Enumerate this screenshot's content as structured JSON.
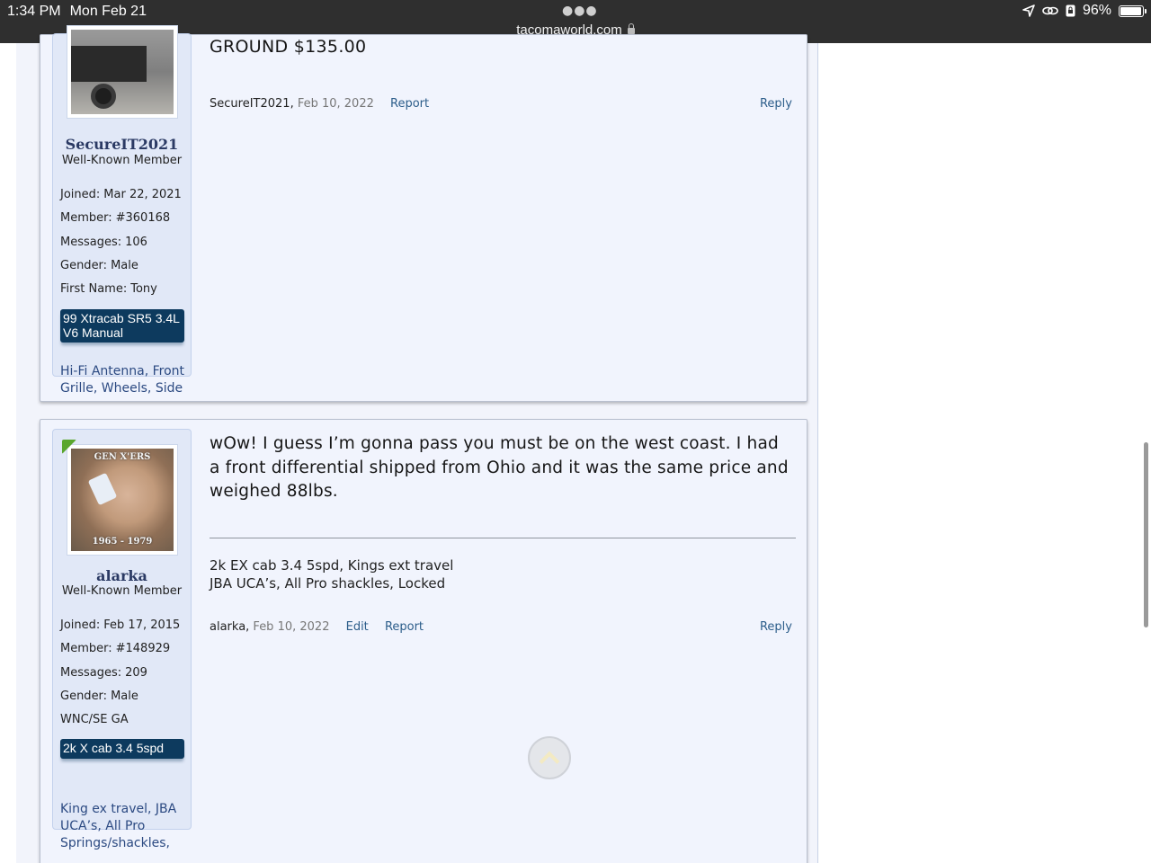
{
  "status_bar": {
    "time": "1:34 PM",
    "date": "Mon Feb 21",
    "url": "tacomaworld.com",
    "battery": "96%",
    "battery_level": 0.96
  },
  "posts": [
    {
      "message": "GROUND $135.00",
      "user": {
        "username": "SecureIT2021",
        "title": "Well-Known Member",
        "stats": [
          {
            "label": "Joined:",
            "value": "Mar 22, 2021"
          },
          {
            "label": "Member:",
            "value": "#360168"
          },
          {
            "label": "Messages:",
            "value": "106"
          },
          {
            "label": "Gender:",
            "value": "Male"
          },
          {
            "label": "First Name:",
            "value": "Tony"
          }
        ],
        "vehicle": "99 Xtracab SR5 3.4L V6 Manual",
        "mods": "Hi-Fi Antenna, Front Grille, Wheels, Side"
      },
      "meta": {
        "author": "SecureIT2021",
        "date": "Feb 10, 2022",
        "report": "Report",
        "reply": "Reply"
      }
    },
    {
      "message": "wOw! I guess I’m gonna pass you must be on the west coast. I had a front differential shipped from Ohio and it was the same price and weighed 88lbs.",
      "signature_line1": "2k EX cab 3.4 5spd, Kings ext travel",
      "signature_line2": "JBA UCA’s, All Pro shackles, Locked",
      "user": {
        "username": "alarka",
        "title": "Well-Known Member",
        "avatar_text_top": "GEN X'ERS",
        "avatar_text_bottom": "1965 - 1979",
        "stats": [
          {
            "label": "Joined:",
            "value": "Feb 17, 2015"
          },
          {
            "label": "Member:",
            "value": "#148929"
          },
          {
            "label": "Messages:",
            "value": "209"
          },
          {
            "label": "Gender:",
            "value": "Male"
          },
          {
            "label": "WNC/SE GA",
            "value": ""
          }
        ],
        "vehicle": "2k X cab 3.4 5spd",
        "mods": "King ex travel, JBA UCA’s, All Pro Springs/shackles,"
      },
      "meta": {
        "author": "alarka",
        "date": "Feb 10, 2022",
        "edit": "Edit",
        "report": "Report",
        "reply": "Reply"
      }
    }
  ]
}
